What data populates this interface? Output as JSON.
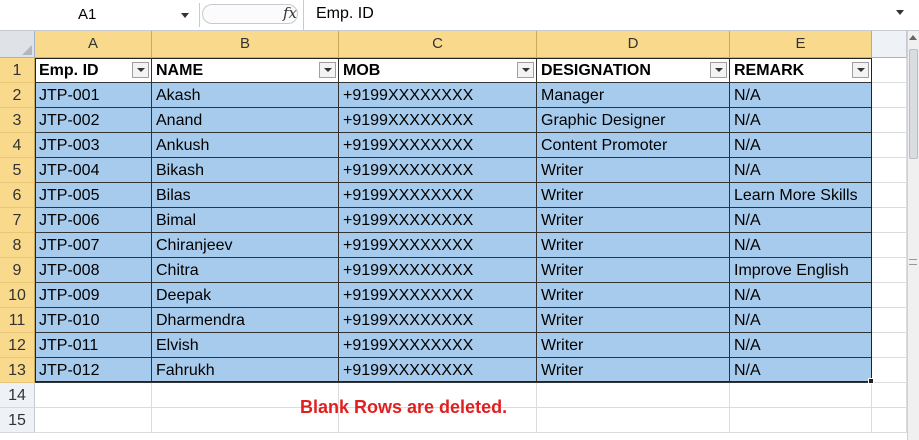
{
  "formula_bar": {
    "name_box": "A1",
    "fx_label": "fx",
    "content": "Emp. ID"
  },
  "columns": [
    "A",
    "B",
    "C",
    "D",
    "E"
  ],
  "rows": [
    "1",
    "2",
    "3",
    "4",
    "5",
    "6",
    "7",
    "8",
    "9",
    "10",
    "11",
    "12",
    "13",
    "14",
    "15"
  ],
  "table": {
    "headers": [
      "Emp. ID",
      "NAME",
      "MOB",
      "DESIGNATION",
      "REMARK"
    ],
    "records": [
      [
        "JTP-001",
        "Akash",
        "+9199XXXXXXXX",
        "Manager",
        "N/A"
      ],
      [
        "JTP-002",
        "Anand",
        "+9199XXXXXXXX",
        "Graphic Designer",
        "N/A"
      ],
      [
        "JTP-003",
        "Ankush",
        "+9199XXXXXXXX",
        "Content Promoter",
        "N/A"
      ],
      [
        "JTP-004",
        "Bikash",
        "+9199XXXXXXXX",
        "Writer",
        "N/A"
      ],
      [
        "JTP-005",
        "Bilas",
        "+9199XXXXXXXX",
        "Writer",
        "Learn More Skills"
      ],
      [
        "JTP-006",
        "Bimal",
        "+9199XXXXXXXX",
        "Writer",
        "N/A"
      ],
      [
        "JTP-007",
        "Chiranjeev",
        "+9199XXXXXXXX",
        "Writer",
        "N/A"
      ],
      [
        "JTP-008",
        "Chitra",
        "+9199XXXXXXXX",
        "Writer",
        "Improve English"
      ],
      [
        "JTP-009",
        "Deepak",
        "+9199XXXXXXXX",
        "Writer",
        "N/A"
      ],
      [
        "JTP-010",
        "Dharmendra",
        "+9199XXXXXXXX",
        "Writer",
        "N/A"
      ],
      [
        "JTP-011",
        "Elvish",
        "+9199XXXXXXXX",
        "Writer",
        "N/A"
      ],
      [
        "JTP-012",
        "Fahrukh",
        "+9199XXXXXXXX",
        "Writer",
        "N/A"
      ]
    ]
  },
  "note": "Blank Rows are deleted.",
  "colors": {
    "selection_fill": "#a7cbec",
    "header_highlight": "#f9d98c",
    "note_text": "#e02020"
  }
}
